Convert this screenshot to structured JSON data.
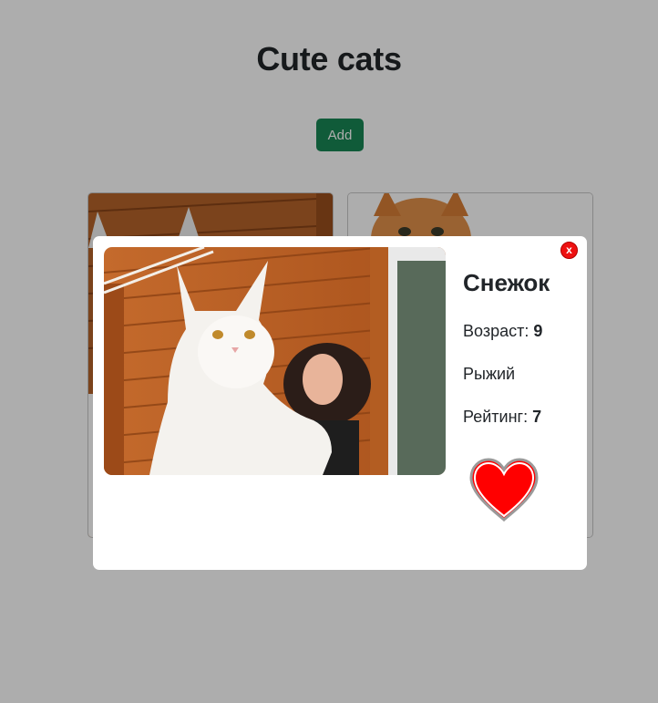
{
  "page": {
    "title": "Cute cats",
    "add_button": "Add"
  },
  "cards": [
    {
      "image": "cat-photo"
    },
    {
      "image": "cat-photo"
    }
  ],
  "modal": {
    "close_label": "x",
    "cat_name": "Снежок",
    "age_label": "Возраст:",
    "age_value": "9",
    "color_text": "Рыжий",
    "rating_label": "Рейтинг:",
    "rating_value": "7",
    "favorite_icon": "heart-icon",
    "favorite_color": "#ff0000"
  },
  "colors": {
    "add_button": "#198754",
    "overlay": "rgba(0,0,0,0.32)",
    "close_button": "#ee1111"
  }
}
